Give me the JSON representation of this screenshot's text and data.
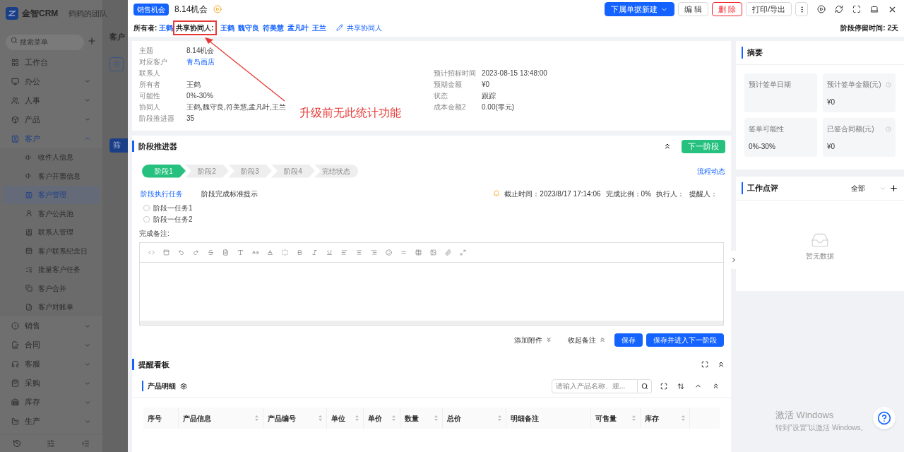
{
  "sidebar": {
    "brand": "金智CRM",
    "team": "鹤鹤的团队",
    "search": {
      "placeholder": "搜索菜单"
    },
    "items": [
      {
        "label": "工作台",
        "selected": false
      },
      {
        "label": "办公",
        "expandable": true,
        "expanded": false,
        "selected": false
      },
      {
        "label": "人事",
        "expandable": true,
        "expanded": false,
        "selected": false
      },
      {
        "label": "产品",
        "expandable": true,
        "expanded": false,
        "selected": false
      },
      {
        "label": "客户",
        "expandable": true,
        "expanded": true,
        "selected": true,
        "children": [
          {
            "label": "收件人信息",
            "selected": false
          },
          {
            "label": "客户开票信息",
            "selected": false
          },
          {
            "label": "客户管理",
            "selected": true
          },
          {
            "label": "客户公共池",
            "selected": false
          },
          {
            "label": "联系人管理",
            "selected": false
          },
          {
            "label": "客户联系纪念日",
            "selected": false
          },
          {
            "label": "批量客户任务",
            "selected": false
          },
          {
            "label": "客户合并",
            "selected": false
          },
          {
            "label": "客户对账单",
            "selected": false
          }
        ]
      },
      {
        "label": "销售",
        "expandable": true,
        "expanded": false,
        "selected": false
      },
      {
        "label": "合同",
        "expandable": true,
        "expanded": false,
        "selected": false
      },
      {
        "label": "客服",
        "expandable": true,
        "expanded": false,
        "selected": false
      },
      {
        "label": "采购",
        "expandable": true,
        "expanded": false,
        "selected": false
      },
      {
        "label": "库存",
        "expandable": true,
        "expanded": false,
        "selected": false
      },
      {
        "label": "生产",
        "expandable": true,
        "expanded": false,
        "selected": false
      }
    ]
  },
  "background_page": {
    "title": "客户",
    "filter_button": "筛"
  },
  "drawer": {
    "badge": "销售机会",
    "title": "8.14机会",
    "actions": [
      {
        "label": "下属单据新建",
        "kind": "primary"
      },
      {
        "label": "编 辑",
        "kind": "default"
      },
      {
        "label": "删 除",
        "kind": "danger"
      },
      {
        "label": "打印/导出",
        "kind": "default"
      }
    ],
    "owner_label": "所有者:",
    "owner": "王鹤",
    "shared_label": "共享协同人:",
    "shared_people": [
      "王鹤",
      "魏守良",
      "符美慧",
      "孟凡叶",
      "王兰"
    ],
    "shared_edit": "共享协同人",
    "stay_time": "阶段停留时间: 2天",
    "annotation": "升级前无此统计功能",
    "fields_left": [
      {
        "label": "主题",
        "value": "8.14机会"
      },
      {
        "label": "对应客户",
        "value": "青岛画店",
        "link": true
      },
      {
        "label": "联系人"
      },
      {
        "label": "所有者",
        "value": "王鹤"
      },
      {
        "label": "可能性",
        "value": "0%-30%"
      },
      {
        "label": "协同人",
        "value": "王鹤,魏守良,符美慧,孟凡叶,王兰"
      },
      {
        "label": "阶段推进器",
        "value": "35"
      }
    ],
    "fields_right": [
      {
        "label": "预计招标时间",
        "value": "2023-08-15 13:48:00"
      },
      {
        "label": "预期金额",
        "value": "¥0"
      },
      {
        "label": "状态",
        "value": "跟踪"
      },
      {
        "label": "成本金额2",
        "value": "0.00(零元)"
      }
    ],
    "stage_section": {
      "title": "阶段推进器",
      "next_button": "下一阶段",
      "flow_link": "流程动态",
      "stages": [
        {
          "label": "阶段1",
          "selected": true
        },
        {
          "label": "阶段2",
          "selected": false
        },
        {
          "label": "阶段3",
          "selected": false
        },
        {
          "label": "阶段4",
          "selected": false
        },
        {
          "label": "完结状态",
          "selected": false
        }
      ],
      "tabs": [
        {
          "label": "阶段执行任务",
          "selected": true
        },
        {
          "label": "阶段完成标准提示",
          "selected": false
        }
      ],
      "meta": [
        "截止时间：2023/8/17 17:14:06",
        "完成比例：0%",
        "执行人：",
        "提醒人："
      ],
      "tasks": [
        {
          "label": "阶段一任务1",
          "checked": false
        },
        {
          "label": "阶段一任务2",
          "checked": false
        }
      ],
      "note_label": "完成备注:",
      "attach": "添加附件",
      "collapse": "收起备注",
      "save": "保存",
      "save_next": "保存并进入下一阶段"
    },
    "reminder_title": "提醒看板",
    "products": {
      "title": "产品明细",
      "search": {
        "placeholder": "请输入产品名称、规..."
      },
      "columns": [
        {
          "label": "序号",
          "sortable": false
        },
        {
          "label": "产品信息",
          "sortable": true
        },
        {
          "label": "产品编号",
          "sortable": true
        },
        {
          "label": "单位",
          "sortable": true
        },
        {
          "label": "单价",
          "sortable": true
        },
        {
          "label": "数量",
          "sortable": true
        },
        {
          "label": "总价",
          "sortable": true
        },
        {
          "label": "明细备注",
          "sortable": false
        },
        {
          "label": "可售量",
          "sortable": true
        },
        {
          "label": "库存",
          "sortable": true
        }
      ]
    },
    "summary": {
      "title": "摘要",
      "cards": [
        {
          "label": "预计签单日期",
          "clock": false
        },
        {
          "label": "预计签单金额(元)",
          "value": "¥0",
          "clock": true
        },
        {
          "label": "签单可能性",
          "value": "0%-30%",
          "clock": false
        },
        {
          "label": "已签合同额(元)",
          "value": "¥0",
          "clock": true
        }
      ]
    },
    "review": {
      "title": "工作点评",
      "filter": "全部",
      "empty": "暂无数据"
    }
  },
  "os_notice": {
    "title": "激活 Windows",
    "subtitle": "转到\"设置\"以激活 Windows。"
  }
}
